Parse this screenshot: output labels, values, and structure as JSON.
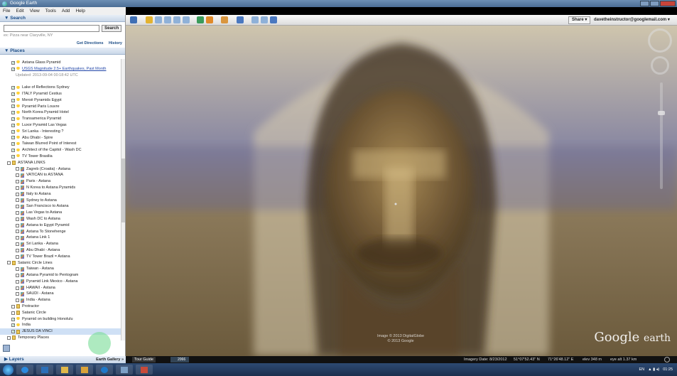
{
  "window": {
    "title": "Google Earth"
  },
  "menu": [
    "File",
    "Edit",
    "View",
    "Tools",
    "Add",
    "Help"
  ],
  "search": {
    "header": "▼ Search",
    "button_label": "Search",
    "hint": "ex: Pizza near Claryville, NY",
    "get_directions": "Get Directions",
    "history": "History"
  },
  "places": {
    "header": "▼ Places",
    "items": [
      {
        "label": "Astana Glass Pyramid",
        "icon": "pin",
        "indent": 2,
        "checked": true
      },
      {
        "label": "USGS Magnitude 2.5+ Earthquakes, Past Month",
        "icon": "pin",
        "indent": 2,
        "checked": true,
        "link": true
      },
      {
        "label": "Updated: 2013-09-04 00:18:42 UTC",
        "icon": "none",
        "indent": 3,
        "note": true
      },
      {
        "label": "",
        "icon": "none",
        "indent": 0,
        "spacer": true
      },
      {
        "label": "Lake of Reflections Sydney",
        "icon": "pin",
        "indent": 2,
        "checked": true
      },
      {
        "label": "ITALY Pyramid Cestius",
        "icon": "pin",
        "indent": 2,
        "checked": true
      },
      {
        "label": "Meroë Pyramids Egypt",
        "icon": "pin",
        "indent": 2,
        "checked": true
      },
      {
        "label": "Pyramid Paris Louvre",
        "icon": "pin",
        "indent": 2,
        "checked": true
      },
      {
        "label": "North Korea Pyramid Hotel",
        "icon": "pin",
        "indent": 2,
        "checked": true
      },
      {
        "label": "Transamerica Pyramid",
        "icon": "pin",
        "indent": 2,
        "checked": true
      },
      {
        "label": "Luxor Pyramid Las Vegas",
        "icon": "pin",
        "indent": 2,
        "checked": true
      },
      {
        "label": "Sri Lanka - Interesting ?",
        "icon": "pin",
        "indent": 2,
        "checked": true
      },
      {
        "label": "Abu Dhabi - Spire",
        "icon": "pin",
        "indent": 2,
        "checked": true
      },
      {
        "label": "Taiwan Blurred Point of Interest",
        "icon": "pin",
        "indent": 2,
        "checked": true
      },
      {
        "label": "Architect of the Capitol - Wash DC",
        "icon": "pin",
        "indent": 2,
        "checked": true
      },
      {
        "label": "TV Tower Brasilia",
        "icon": "pin",
        "indent": 2,
        "checked": true
      },
      {
        "label": "ASTANA LINKS",
        "icon": "folder",
        "indent": 1,
        "checked": false
      },
      {
        "label": "Zagreb (Croatia) - Astana",
        "icon": "path",
        "indent": 3,
        "checked": false
      },
      {
        "label": "VATICAN to ASTANA",
        "icon": "path",
        "indent": 3,
        "checked": false
      },
      {
        "label": "Paris - Astana",
        "icon": "path",
        "indent": 3,
        "checked": false
      },
      {
        "label": "N Korea to Astana Pyramids",
        "icon": "path",
        "indent": 3,
        "checked": false
      },
      {
        "label": "Italy to Astana",
        "icon": "path",
        "indent": 3,
        "checked": false
      },
      {
        "label": "Sydney to Astana",
        "icon": "path",
        "indent": 3,
        "checked": false
      },
      {
        "label": "San Francisco to Astana",
        "icon": "path",
        "indent": 3,
        "checked": false
      },
      {
        "label": "Las Vegas to Astana",
        "icon": "path",
        "indent": 3,
        "checked": false
      },
      {
        "label": "Wash DC to Astana",
        "icon": "path",
        "indent": 3,
        "checked": false
      },
      {
        "label": "Astana to Egypt Pyramid",
        "icon": "path",
        "indent": 3,
        "checked": false
      },
      {
        "label": "Astana To Stonehenge",
        "icon": "path",
        "indent": 3,
        "checked": false
      },
      {
        "label": "Astana Link 1",
        "icon": "path",
        "indent": 3,
        "checked": false
      },
      {
        "label": "Sri Lanka - Astana",
        "icon": "path",
        "indent": 3,
        "checked": false
      },
      {
        "label": "Abu Dhabi - Astana",
        "icon": "path",
        "indent": 3,
        "checked": false
      },
      {
        "label": "TV Tower Brazil = Astana",
        "icon": "path",
        "indent": 3,
        "checked": false
      },
      {
        "label": "Satanic Circle Lines",
        "icon": "folder",
        "indent": 1,
        "checked": false
      },
      {
        "label": "Taiwan - Astana",
        "icon": "path",
        "indent": 3,
        "checked": false
      },
      {
        "label": "Astana Pyramid to Pentogram",
        "icon": "path",
        "indent": 3,
        "checked": false
      },
      {
        "label": "Pyramid Link Mexico - Astana",
        "icon": "path",
        "indent": 3,
        "checked": false
      },
      {
        "label": "HAWAII - Astana",
        "icon": "path",
        "indent": 3,
        "checked": false
      },
      {
        "label": "SAUDI - Astana",
        "icon": "path",
        "indent": 3,
        "checked": false
      },
      {
        "label": "India - Astana",
        "icon": "path",
        "indent": 3,
        "checked": false
      },
      {
        "label": "Protractor",
        "icon": "folder",
        "indent": 2,
        "checked": false
      },
      {
        "label": "Satanic Circle",
        "icon": "folder",
        "indent": 2,
        "checked": false
      },
      {
        "label": "Pyramid on building Honolulu",
        "icon": "pin",
        "indent": 2,
        "checked": true
      },
      {
        "label": "India",
        "icon": "pin",
        "indent": 2,
        "checked": true
      },
      {
        "label": "JESUS DA VINCI",
        "icon": "folder",
        "indent": 2,
        "checked": true,
        "selected": true
      },
      {
        "label": "Temporary Places",
        "icon": "folder",
        "indent": 1,
        "checked": false
      }
    ]
  },
  "layers": {
    "header": "▶ Layers",
    "gallery": "Earth Gallery »"
  },
  "toolbar": {
    "share": "Share ▾",
    "account": "davetheinstructor@googlemail.com ▾"
  },
  "map": {
    "logo_word1": "Google",
    "logo_word2": "earth",
    "copyright_line1": "Image © 2013 DigitalGlobe",
    "copyright_line2": "© 2013 Google"
  },
  "status": {
    "imagery_date": "Imagery Date: 8/23/2012",
    "lat": "51°07'52.43\" N",
    "lon": "71°26'48.12\" E",
    "elev": "elev  348 m",
    "eye": "eye alt  1.37 km"
  },
  "tour": {
    "label": "Tour Guide",
    "thumb": "2066"
  },
  "taskbar": {
    "lang": "EN",
    "time": "01:25"
  }
}
